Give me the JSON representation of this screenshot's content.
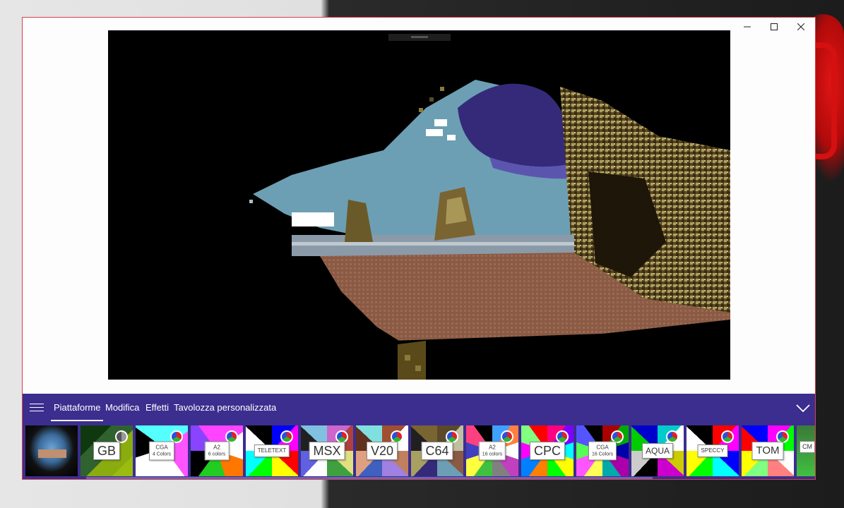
{
  "window": {
    "controls": [
      "minimize-icon",
      "maximize-icon",
      "close-icon"
    ]
  },
  "nav": {
    "menu_icon": "hamburger-icon",
    "tabs": [
      {
        "label": "Piattaforme",
        "active": true
      },
      {
        "label": "Modifica",
        "active": false
      },
      {
        "label": "Effetti",
        "active": false
      },
      {
        "label": "Tavolozza personalizzata",
        "active": false
      }
    ],
    "collapse_icon": "chevron-down-icon"
  },
  "thumbnails": [
    {
      "label": "",
      "sub": "",
      "type": "original"
    },
    {
      "label": "GB",
      "sub": "",
      "type": "gb"
    },
    {
      "label": "CGA",
      "sub": "4 Colors",
      "type": "cga4"
    },
    {
      "label": "A2",
      "sub": "6 colors",
      "type": "a2-6"
    },
    {
      "label": "TELETEXT",
      "sub": "",
      "type": "teletext"
    },
    {
      "label": "MSX",
      "sub": "",
      "type": "msx"
    },
    {
      "label": "V20",
      "sub": "",
      "type": "v20"
    },
    {
      "label": "C64",
      "sub": "",
      "type": "c64"
    },
    {
      "label": "A2",
      "sub": "16 colors",
      "type": "a2-16"
    },
    {
      "label": "CPC",
      "sub": "",
      "type": "cpc"
    },
    {
      "label": "CGA",
      "sub": "16 Colors",
      "type": "cga16"
    },
    {
      "label": "AQUA",
      "sub": "",
      "type": "aqua"
    },
    {
      "label": "SPECCY",
      "sub": "",
      "type": "speccy"
    },
    {
      "label": "TOM",
      "sub": "",
      "type": "tom"
    },
    {
      "label": "C",
      "sub": "M",
      "type": "partial"
    }
  ],
  "colors": {
    "accent": "#3b2e8e",
    "window_border": "#d8414a"
  }
}
